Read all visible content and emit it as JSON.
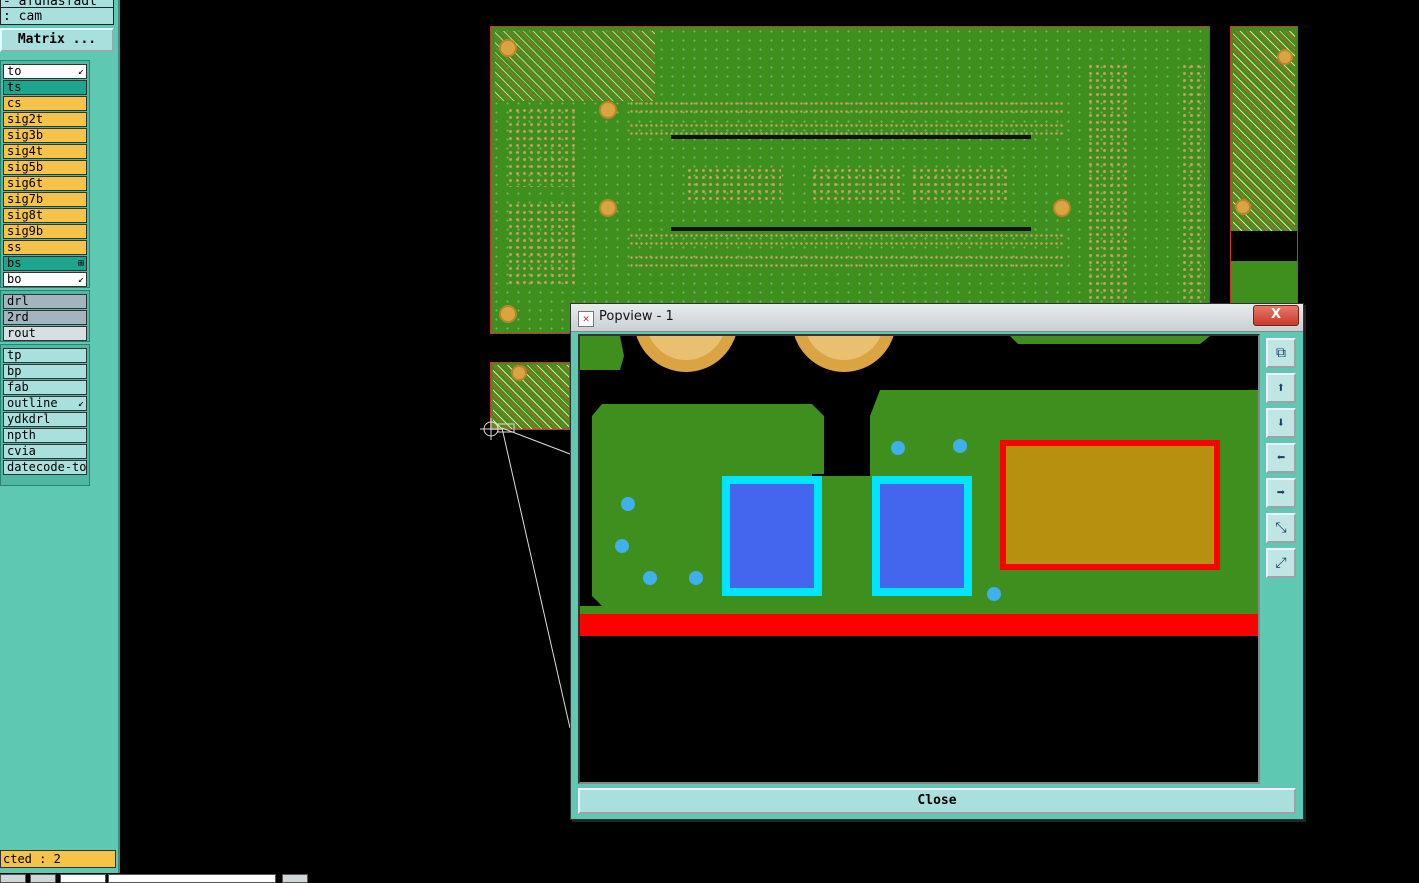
{
  "left_panel": {
    "step_label": "- afdnasfadt",
    "job_label": ": cam",
    "matrix_button": "Matrix ...",
    "layers_top": [
      {
        "name": "to",
        "color": "#ffffff",
        "mark": "↙"
      },
      {
        "name": "ts",
        "color": "#1fa58d",
        "mark": ""
      },
      {
        "name": "cs",
        "color": "#f5c24a",
        "mark": ""
      },
      {
        "name": "sig2t",
        "color": "#f5c24a",
        "mark": ""
      },
      {
        "name": "sig3b",
        "color": "#f5c24a",
        "mark": ""
      },
      {
        "name": "sig4t",
        "color": "#f5c24a",
        "mark": ""
      },
      {
        "name": "sig5b",
        "color": "#f5c24a",
        "mark": ""
      },
      {
        "name": "sig6t",
        "color": "#f5c24a",
        "mark": ""
      },
      {
        "name": "sig7b",
        "color": "#f5c24a",
        "mark": ""
      },
      {
        "name": "sig8t",
        "color": "#f5c24a",
        "mark": ""
      },
      {
        "name": "sig9b",
        "color": "#f5c24a",
        "mark": ""
      },
      {
        "name": "ss",
        "color": "#f5c24a",
        "mark": ""
      },
      {
        "name": "bs",
        "color": "#1fa58d",
        "mark": "⊞"
      },
      {
        "name": "bo",
        "color": "#ffffff",
        "mark": "↙"
      }
    ],
    "layers_drill": [
      {
        "name": "drl",
        "color": "#a3b4be"
      },
      {
        "name": "2rd",
        "color": "#a3b4be"
      },
      {
        "name": "rout",
        "color": "#d7dfe2"
      }
    ],
    "layers_misc": [
      {
        "name": "tp",
        "color": "#a9e0dd",
        "mark": ""
      },
      {
        "name": "bp",
        "color": "#a9e0dd",
        "mark": ""
      },
      {
        "name": "fab",
        "color": "#a9e0dd",
        "mark": ""
      },
      {
        "name": "outline",
        "color": "#a9e0dd",
        "mark": "↙"
      },
      {
        "name": "ydkdrl",
        "color": "#a9e0dd",
        "mark": ""
      },
      {
        "name": "npth",
        "color": "#a9e0dd",
        "mark": ""
      },
      {
        "name": "cvia",
        "color": "#a9e0dd",
        "mark": ""
      },
      {
        "name": "datecode-to",
        "color": "#a9e0dd",
        "mark": ""
      }
    ],
    "status": "cted : 2"
  },
  "popview": {
    "title": "Popview - 1",
    "close_x": "X",
    "close_button": "Close",
    "tools": [
      {
        "icon": "zoom-window-icon",
        "glyph": "⧉"
      },
      {
        "icon": "pan-up-icon",
        "glyph": "⬆"
      },
      {
        "icon": "pan-down-icon",
        "glyph": "⬇"
      },
      {
        "icon": "pan-left-icon",
        "glyph": "⬅"
      },
      {
        "icon": "pan-right-icon",
        "glyph": "➡"
      },
      {
        "icon": "zoom-in-icon",
        "glyph": "⤡"
      },
      {
        "icon": "zoom-out-icon",
        "glyph": "⤢"
      }
    ]
  }
}
